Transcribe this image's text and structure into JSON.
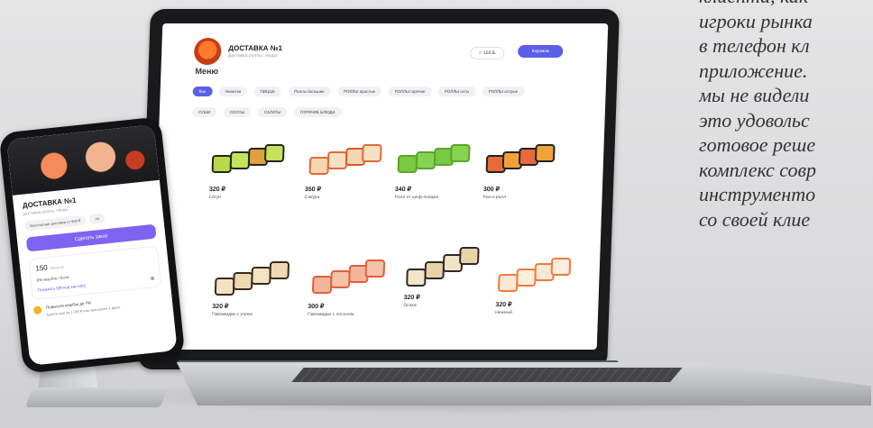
{
  "laptop": {
    "brand_title": "ДОСТАВКА №1",
    "brand_sub": "Доставка роллы, пицца",
    "bonus": "☆ 150 Б.",
    "cart": "Корзина",
    "menu_title": "Меню",
    "categories": [
      "Все",
      "Напитки",
      "ПИЦЦА",
      "Роллы большие",
      "РОЛЛЫ простые",
      "РОЛЛЫ горячие",
      "РОЛЛЫ сеты",
      "РОЛЛЫ острые",
      "СУШИ",
      "СОУСЫ",
      "САЛАТЫ",
      "ГОРЯЧИЕ БЛЮДА"
    ],
    "products": [
      {
        "price": "320 ₽",
        "name": "Сёгун"
      },
      {
        "price": "350 ₽",
        "name": "Сакура"
      },
      {
        "price": "340 ₽",
        "name": "Ролл от шеф-повара"
      },
      {
        "price": "300 ₽",
        "name": "Рок-н-ролл"
      },
      {
        "price": "320 ₽",
        "name": "Пирамидки с угрем"
      },
      {
        "price": "300 ₽",
        "name": "Пирамидки с лососем"
      },
      {
        "price": "320 ₽",
        "name": "Осака"
      },
      {
        "price": "320 ₽",
        "name": "Нежный"
      }
    ]
  },
  "phone": {
    "title": "ДОСТАВКА №1",
    "subtitle": "Доставка роллы, пицца",
    "pill_delivery": "Бесплатная доставка от 900 ₽",
    "pill_more": "Ул",
    "order_button": "Сделать заказ",
    "balance": "150",
    "balance_unit": "бонусов",
    "cashback": "6% кешбэк / Бонс",
    "qr": "Показать QR-код кассиру",
    "promo_title": "Повысьте кешбэк до 7%",
    "promo_sub": "Купите еще на 1 350 ₽ или пригласите 1 друга"
  },
  "side_text": {
    "lines": [
      "клиента, как",
      "игроки рынка",
      "в телефон кл",
      "приложение.",
      "мы не видели",
      "это удовольс",
      "готовое реше",
      "комплекс совр",
      "инструменто",
      "со своей клие"
    ]
  }
}
